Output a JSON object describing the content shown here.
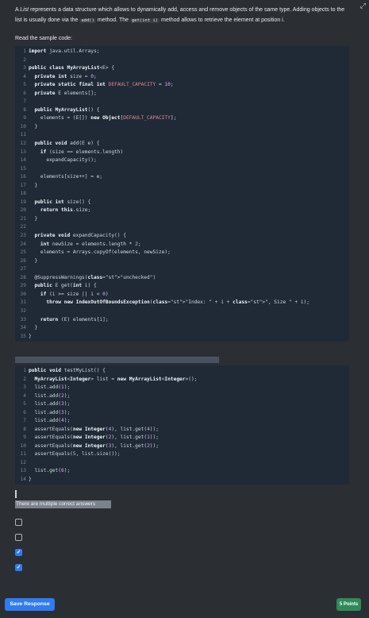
{
  "intro": {
    "part1": "A ",
    "list_word": "List",
    "part2": " represents a data structure which allows to dynamically add, access and remove objects of the same type. Adding objects to the list is usually done via the ",
    "add_code": "add()",
    "part3": " method. The ",
    "get_code": "get(int i)",
    "part4": " method allows to retrieve the element at position i."
  },
  "read_label": "Read the sample code:",
  "code1_lines": [
    "import java.util.Arrays;",
    "",
    "public class MyArrayList<E> {",
    "  private int size = 0;",
    "  private static final int DEFAULT_CAPACITY = 10;",
    "  private E elements[];",
    "",
    "  public MyArrayList() {",
    "    elements = (E[]) new Object[DEFAULT_CAPACITY];",
    "  }",
    "",
    "  public void add(E e) {",
    "    if (size == elements.length)",
    "      expandCapacity();",
    "",
    "    elements[size++] = e;",
    "  }",
    "",
    "  public int size() {",
    "    return this.size;",
    "  }",
    "",
    "  private void expandCapacity() {",
    "    int newSize = elements.length * 2;",
    "    elements = Arrays.copyOf(elements, newSize);",
    "  }",
    "",
    "  @SuppressWarnings(\"unchecked\")",
    "  public E get(int i) {",
    "    if (i >= size || i < 0)",
    "      throw new IndexOutOfBoundsException(\"Index: \" + i + \", Size \" + i);",
    "",
    "    return (E) elements[i];",
    "  }",
    "}"
  ],
  "code2_lines": [
    "public void testMyList() {",
    "  MyArrayList<Integer> list = new MyArrayList<Integer>();",
    "  list.add(1);",
    "  list.add(2);",
    "  list.add(3);",
    "  list.add(3);",
    "  list.add(4);",
    "  assertEquals(new Integer(4), list.get(4));",
    "  assertEquals(new Integer(2), list.get(1));",
    "  assertEquals(new Integer(3), list.get(2));",
    "  assertEquals(5, list.size());",
    "",
    "  list.get(6);",
    "}"
  ],
  "multi_label": "There are multiple correct answers",
  "options": [
    {
      "checked": false
    },
    {
      "checked": false
    },
    {
      "checked": true
    },
    {
      "checked": true
    }
  ],
  "save_label": "Save Response",
  "points_label": "5 Points",
  "colors": {
    "accent": "#2f7bf0",
    "badge": "#2e8b57",
    "code_bg": "#1f2a36"
  }
}
